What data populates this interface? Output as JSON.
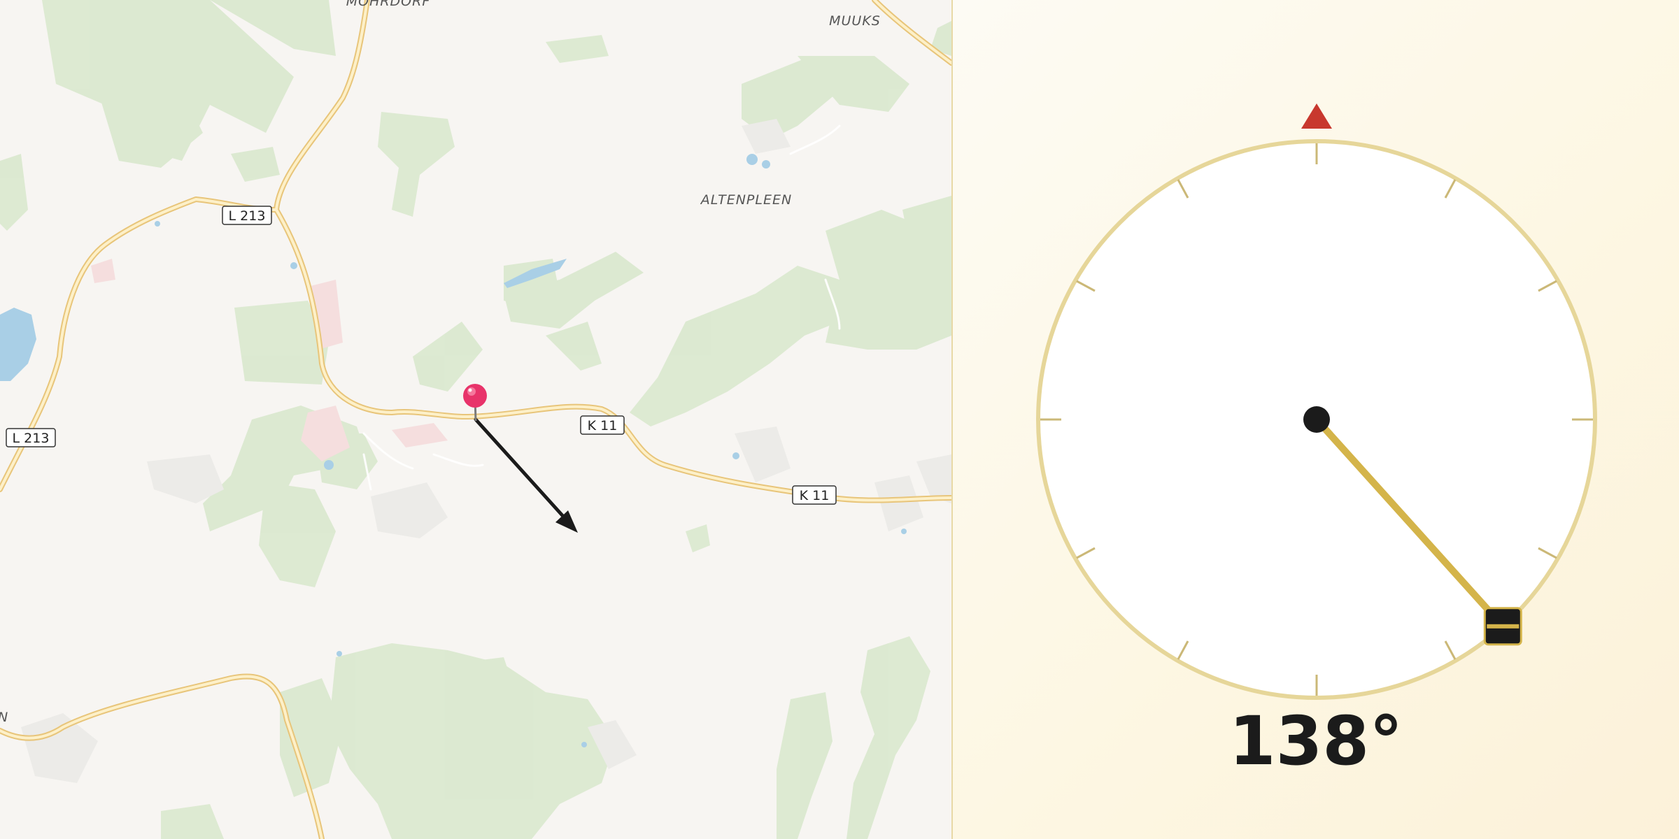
{
  "map": {
    "place_labels": [
      {
        "id": "mohrdorf",
        "text": "MOHRDORF"
      },
      {
        "id": "muuks",
        "text": "MUUKS"
      },
      {
        "id": "altenpleen",
        "text": "ALTENPLEEN"
      }
    ],
    "road_labels": [
      {
        "id": "l213-north",
        "text": "L 213"
      },
      {
        "id": "l213-west",
        "text": "L 213"
      },
      {
        "id": "k11-center",
        "text": "K 11"
      },
      {
        "id": "k11-east",
        "text": "K 11"
      }
    ],
    "edge_label": "N",
    "pin_icon": "map-pin-icon",
    "direction_arrow_icon": "direction-arrow-icon"
  },
  "compass": {
    "bearing_degrees": 138,
    "readout": "138°",
    "north_marker_icon": "north-triangle-icon",
    "needle_handle_icon": "drag-handle-icon",
    "colors": {
      "needle": "#d4b44a",
      "north_marker": "#c8382e",
      "ring": "#e6d699",
      "hub": "#1b1b1b"
    }
  }
}
